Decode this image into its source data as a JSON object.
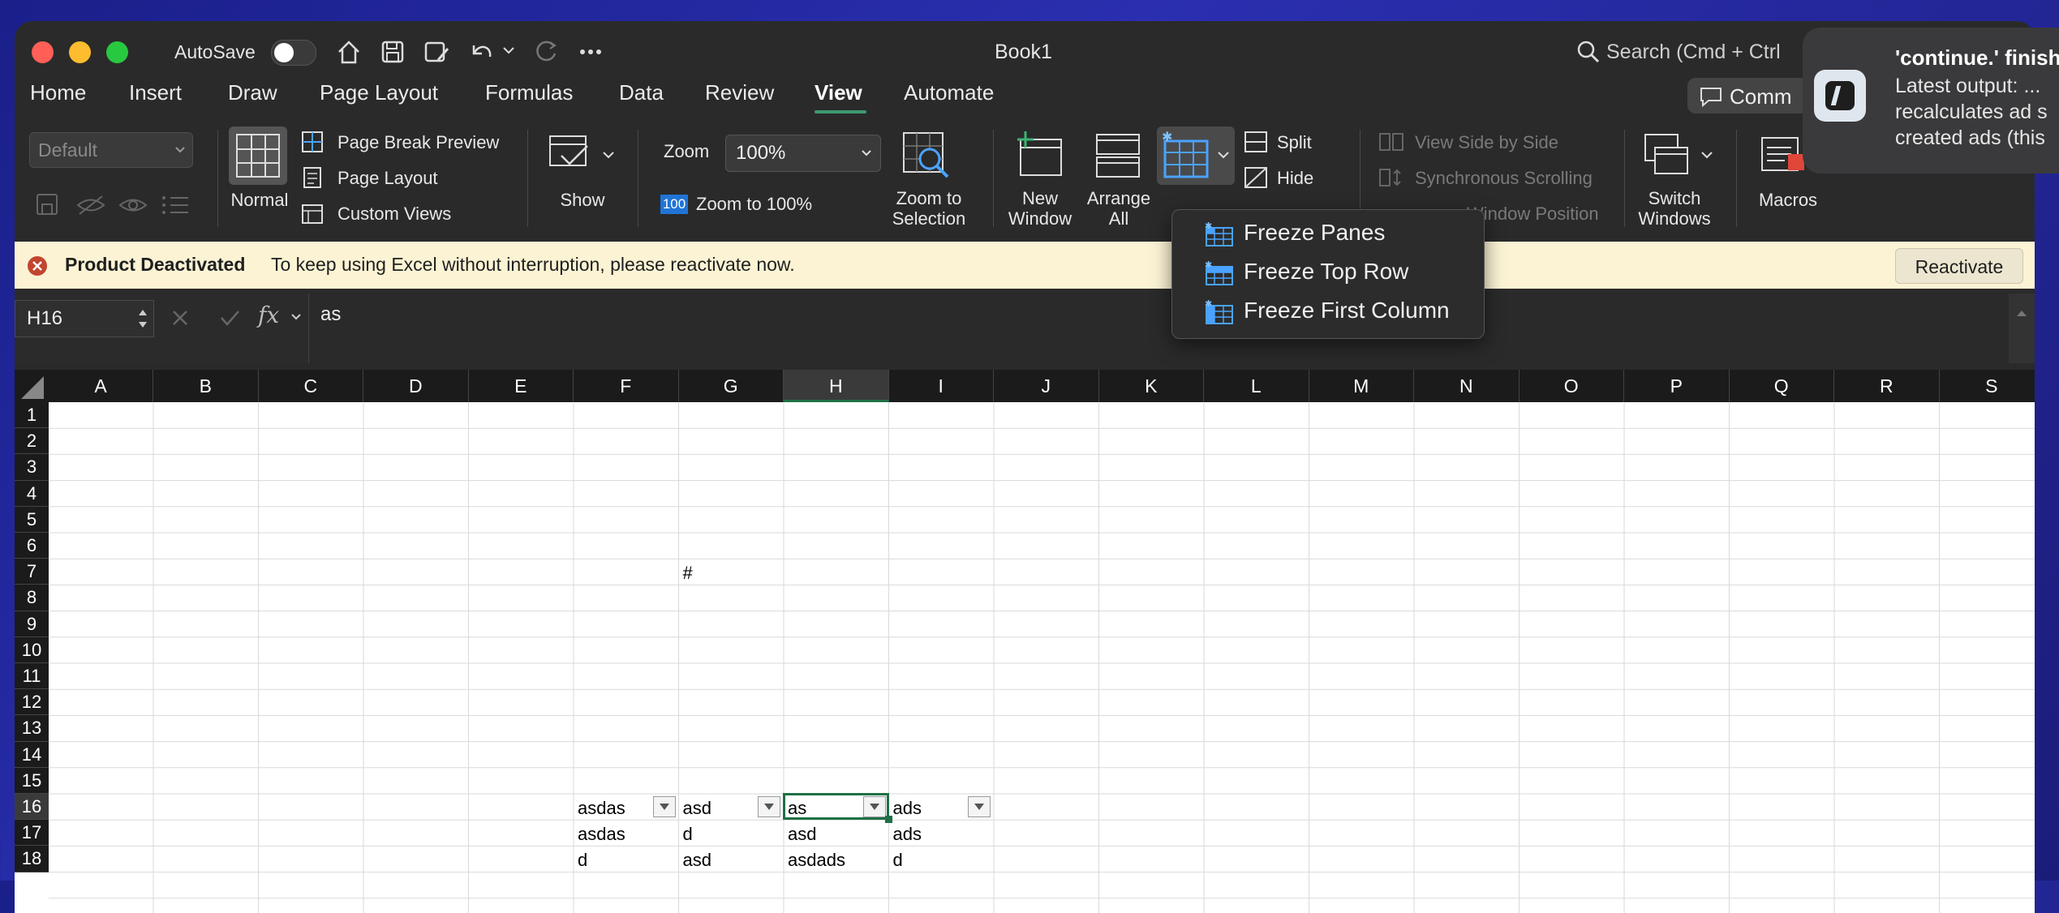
{
  "window": {
    "title": "Book1",
    "autosave_label": "AutoSave",
    "search_placeholder": "Search (Cmd + Ctrl + U)",
    "comments_label": "Comm"
  },
  "tabs": [
    "Home",
    "Insert",
    "Draw",
    "Page Layout",
    "Formulas",
    "Data",
    "Review",
    "View",
    "Automate"
  ],
  "active_tab": "View",
  "ribbon": {
    "sheet_view_value": "Default",
    "normal_label": "Normal",
    "page_break_preview": "Page Break Preview",
    "page_layout": "Page Layout",
    "custom_views": "Custom Views",
    "show_label": "Show",
    "zoom_label": "Zoom",
    "zoom_value": "100%",
    "zoom_100_badge": "100",
    "zoom_to_100": "Zoom to 100%",
    "zoom_to_selection": [
      "Zoom to",
      "Selection"
    ],
    "new_window": [
      "New",
      "Window"
    ],
    "arrange_all": [
      "Arrange",
      "All"
    ],
    "split": "Split",
    "hide": "Hide",
    "view_side_by_side": "View Side by Side",
    "synchronous_scrolling": "Synchronous Scrolling",
    "reset_window_position": "Window Position",
    "switch_windows": [
      "Switch",
      "Windows"
    ],
    "macros": "Macros"
  },
  "freeze_menu": {
    "items": [
      "Freeze Panes",
      "Freeze Top Row",
      "Freeze First Column"
    ]
  },
  "message_bar": {
    "title": "Product Deactivated",
    "text": "To keep using Excel without interruption, please reactivate now.",
    "button": "Reactivate"
  },
  "formula_bar": {
    "name_box": "H16",
    "fx_label": "fx",
    "formula": "as"
  },
  "sheet": {
    "columns": [
      "A",
      "B",
      "C",
      "D",
      "E",
      "F",
      "G",
      "H",
      "I",
      "J",
      "K",
      "L",
      "M",
      "N",
      "O",
      "P",
      "Q",
      "R",
      "S"
    ],
    "rows": [
      "1",
      "2",
      "3",
      "4",
      "5",
      "6",
      "7",
      "8",
      "9",
      "10",
      "11",
      "12",
      "13",
      "14",
      "15",
      "16",
      "17",
      "18"
    ],
    "selected_cell": "H16",
    "cells": [
      {
        "ref": "G7",
        "value": "#"
      },
      {
        "ref": "F16",
        "value": "asdas",
        "filter": true
      },
      {
        "ref": "G16",
        "value": "asd",
        "filter": true
      },
      {
        "ref": "H16",
        "value": "as",
        "filter": true
      },
      {
        "ref": "I16",
        "value": "ads",
        "filter": true
      },
      {
        "ref": "F17",
        "value": "asdas"
      },
      {
        "ref": "G17",
        "value": "d"
      },
      {
        "ref": "H17",
        "value": "asd"
      },
      {
        "ref": "I17",
        "value": "ads"
      },
      {
        "ref": "F18",
        "value": "d"
      },
      {
        "ref": "G18",
        "value": "asd"
      },
      {
        "ref": "H18",
        "value": "asdads"
      },
      {
        "ref": "I18",
        "value": "d"
      }
    ]
  },
  "notification": {
    "title": "'continue.' finish",
    "body": [
      "Latest output: ...",
      "recalculates ad s",
      "created ads (this"
    ]
  }
}
